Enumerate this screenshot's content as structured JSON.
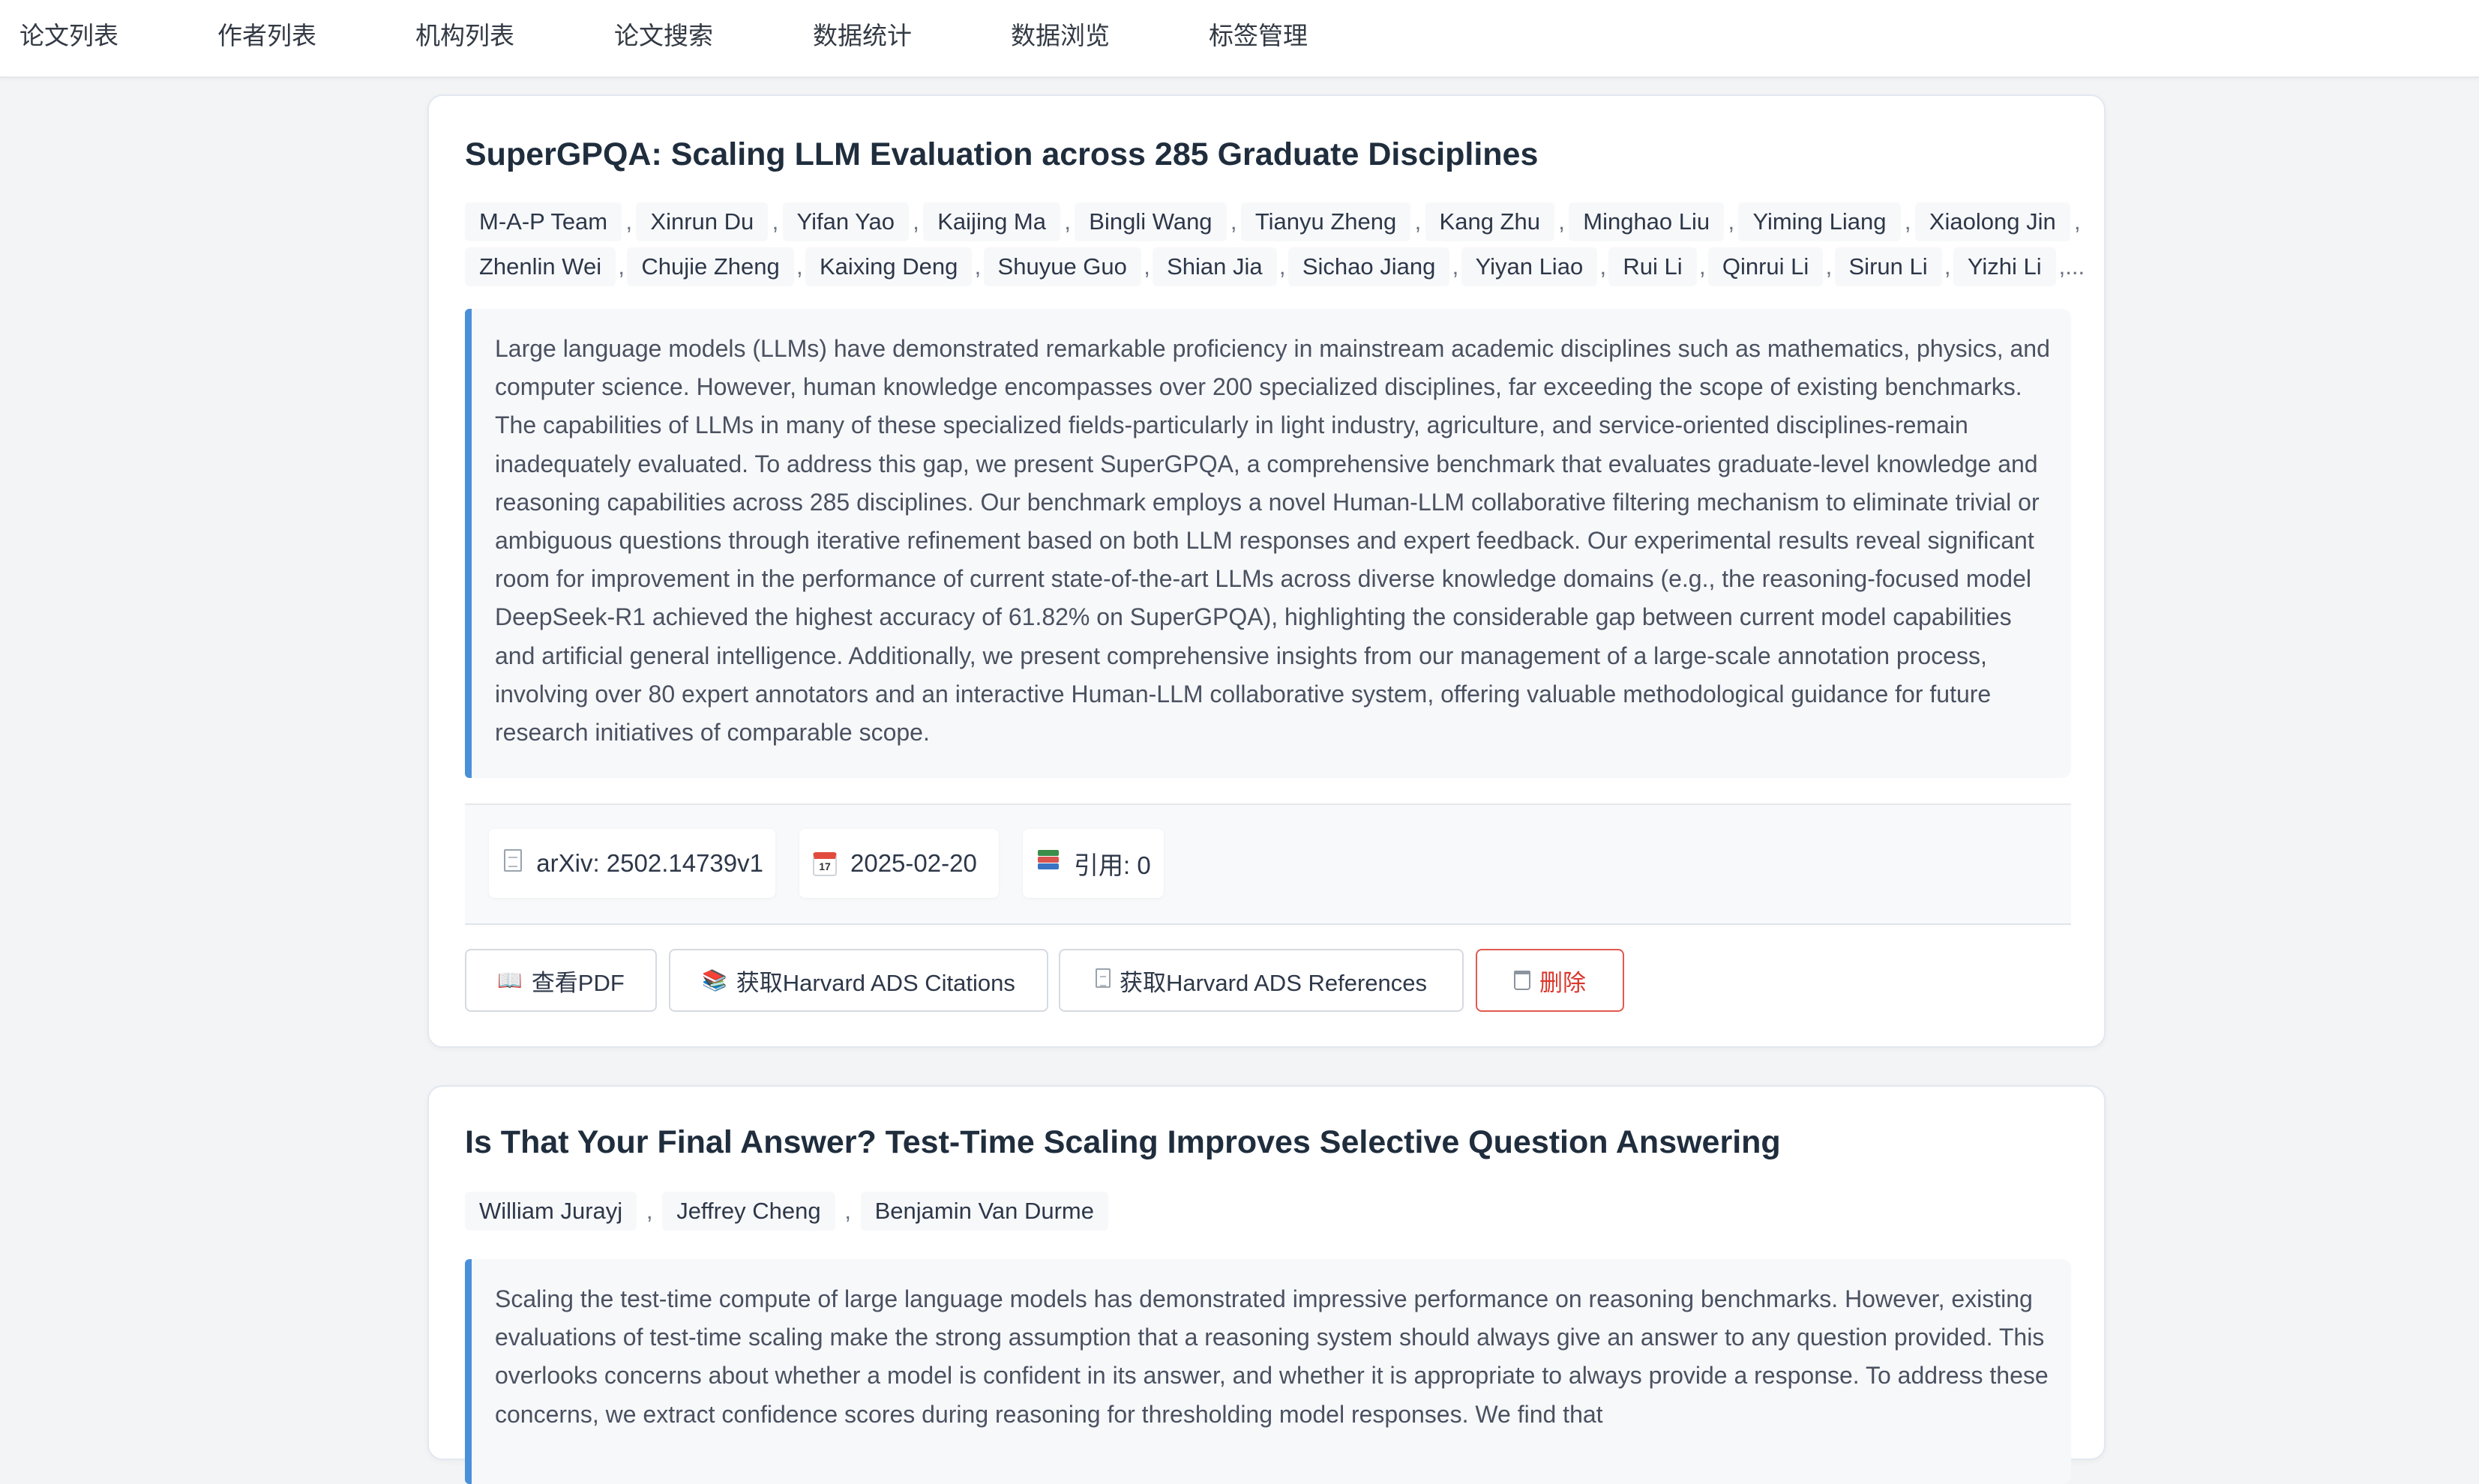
{
  "nav": {
    "items": [
      "论文列表",
      "作者列表",
      "机构列表",
      "论文搜索",
      "数据统计",
      "数据浏览",
      "标签管理"
    ]
  },
  "papers": [
    {
      "title": "SuperGPQA: Scaling LLM Evaluation across 285 Graduate Disciplines",
      "authors_row1": [
        "M-A-P Team",
        "Xinrun Du",
        "Yifan Yao",
        "Kaijing Ma",
        "Bingli Wang",
        "Tianyu Zheng",
        "Kang Zhu",
        "Minghao Liu",
        "Yiming Liang",
        "Xiaolong Jin"
      ],
      "authors_row2": [
        "Zhenlin Wei",
        "Chujie Zheng",
        "Kaixing Deng",
        "Shuyue Guo",
        "Shian Jia",
        "Sichao Jiang",
        "Yiyan Liao",
        "Rui Li",
        "Qinrui Li",
        "Sirun Li",
        "Yizhi Li"
      ],
      "separator": ",",
      "more": ",...",
      "abstract": "Large language models (LLMs) have demonstrated remarkable proficiency in mainstream academic disciplines such as mathematics, physics, and computer science. However, human knowledge encompasses over 200 specialized disciplines, far exceeding the scope of existing benchmarks. The capabilities of LLMs in many of these specialized fields-particularly in light industry, agriculture, and service-oriented disciplines-remain inadequately evaluated. To address this gap, we present SuperGPQA, a comprehensive benchmark that evaluates graduate-level knowledge and reasoning capabilities across 285 disciplines. Our benchmark employs a novel Human-LLM collaborative filtering mechanism to eliminate trivial or ambiguous questions through iterative refinement based on both LLM responses and expert feedback. Our experimental results reveal significant room for improvement in the performance of current state-of-the-art LLMs across diverse knowledge domains (e.g., the reasoning-focused model DeepSeek-R1 achieved the highest accuracy of 61.82% on SuperGPQA), highlighting the considerable gap between current model capabilities and artificial general intelligence. Additionally, we present comprehensive insights from our management of a large-scale annotation process, involving over 80 expert annotators and an interactive Human-LLM collaborative system, offering valuable methodological guidance for future research initiatives of comparable scope.",
      "meta": {
        "arxiv": "arXiv: 2502.14739v1",
        "date": "2025-02-20",
        "calendar_day": "17",
        "citations": "引用: 0"
      },
      "actions": {
        "view_pdf": "查看PDF",
        "ads_citations": "获取Harvard ADS Citations",
        "ads_references": "获取Harvard ADS References",
        "delete": "删除"
      },
      "icons": {
        "view_pdf": "open-book-icon",
        "ads_citations": "books-icon",
        "ads_references": "document-icon",
        "delete": "trash-icon"
      }
    },
    {
      "title": "Is That Your Final Answer? Test-Time Scaling Improves Selective Question Answering",
      "authors_row1": [
        "William Jurayj",
        "Jeffrey Cheng",
        "Benjamin Van Durme"
      ],
      "separator": ",",
      "abstract": "Scaling the test-time compute of large language models has demonstrated impressive performance on reasoning benchmarks. However, existing evaluations of test-time scaling make the strong assumption that a reasoning system should always give an answer to any question provided. This overlooks concerns about whether a model is confident in its answer, and whether it is appropriate to always provide a response. To address these concerns, we extract confidence scores during reasoning for thresholding model responses. We find that"
    }
  ],
  "colors": {
    "accent": "#4a90d9",
    "danger": "#d9362b",
    "background": "#f3f4f6"
  }
}
